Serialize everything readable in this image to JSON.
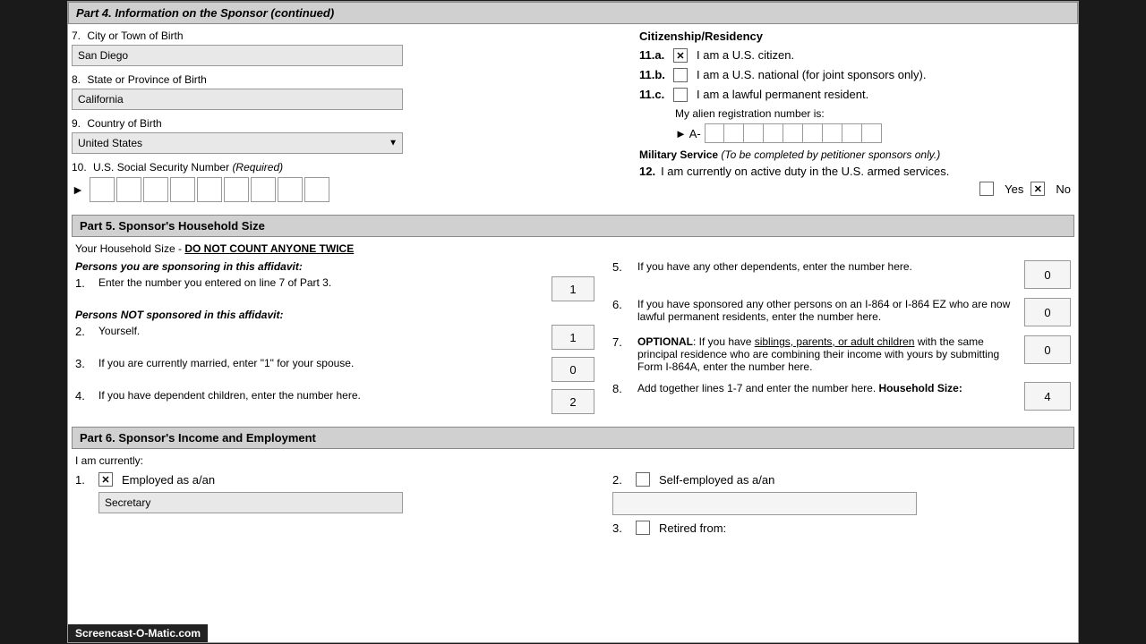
{
  "part4": {
    "header": "Part 4. Information on the Sponsor (continued)",
    "field7_label": "7.",
    "city_label": "City or Town of Birth",
    "city_value": "San Diego",
    "field8_label": "8.",
    "state_label": "State or Province of Birth",
    "state_value": "California",
    "field9_label": "9.",
    "country_label": "Country of Birth",
    "country_value": "United States",
    "field10_label": "10.",
    "ssn_label": "U.S. Social Security Number",
    "ssn_required": "(Required)",
    "ssn_arrow": "►",
    "citizenship_header": "Citizenship/Residency",
    "field11a_label": "11.a.",
    "cit_a": "I am a U.S. citizen.",
    "cit_a_checked": true,
    "field11b_label": "11.b.",
    "cit_b": "I am a U.S. national (for joint sponsors only).",
    "cit_b_checked": false,
    "field11c_label": "11.c.",
    "cit_c": "I am a lawful permanent resident.",
    "cit_c_checked": false,
    "alien_label": "My alien registration number is:",
    "alien_prefix": "► A-",
    "military_header": "Military Service",
    "military_note": "(To be completed by petitioner sponsors only.)",
    "field12_label": "12.",
    "military_text": "I am currently on active duty in the U.S. armed services.",
    "yes_label": "Yes",
    "no_label": "No",
    "yes_checked": false,
    "no_checked": true
  },
  "part5": {
    "header": "Part 5. Sponsor's Household Size",
    "do_not_count": "DO NOT COUNT ANYONE TWICE",
    "household_intro": "Your Household Size -",
    "persons_sponsoring": "Persons you are sponsoring in this affidavit:",
    "persons_not_sponsored": "Persons NOT sponsored in this affidavit:",
    "items_left": [
      {
        "num": "1.",
        "text": "Enter the number you entered on line 7 of Part 3.",
        "value": "1"
      },
      {
        "num": "2.",
        "text": "Yourself.",
        "value": "1"
      },
      {
        "num": "3.",
        "text": "If you are currently married, enter \"1\" for your spouse.",
        "value": "0"
      },
      {
        "num": "4.",
        "text": "If you have dependent children, enter the number here.",
        "value": "2"
      }
    ],
    "items_right": [
      {
        "num": "5.",
        "text": "If you have any other dependents, enter the number here.",
        "value": "0"
      },
      {
        "num": "6.",
        "text": "If you have sponsored any other persons on an I-864 or I-864 EZ who are now lawful permanent residents, enter the number here.",
        "value": "0"
      },
      {
        "num": "7.",
        "text_bold": "OPTIONAL",
        "text_main": ": If you have",
        "text_underline": "siblings, parents, or adult children",
        "text_cont": "with the same principal residence who are combining their income with yours by submitting Form I-864A, enter the number here.",
        "value": "0"
      },
      {
        "num": "8.",
        "text_pre": "Add together lines 1-7 and enter the number here.",
        "text_bold": "Household Size:",
        "value": "4"
      }
    ]
  },
  "part6": {
    "header": "Part 6. Sponsor's Income and Employment",
    "currently_label": "I am currently:",
    "field1_label": "1.",
    "employed_checked": true,
    "employed_label": "Employed as a/an",
    "employed_value": "Secretary",
    "field2_label": "2.",
    "self_employed_checked": false,
    "self_employed_label": "Self-employed as a/an",
    "self_employed_value": "",
    "field3_label": "3.",
    "retired_checked": false,
    "retired_label": "Retired from:"
  },
  "screencast": "Screencast-O-Matic.com"
}
